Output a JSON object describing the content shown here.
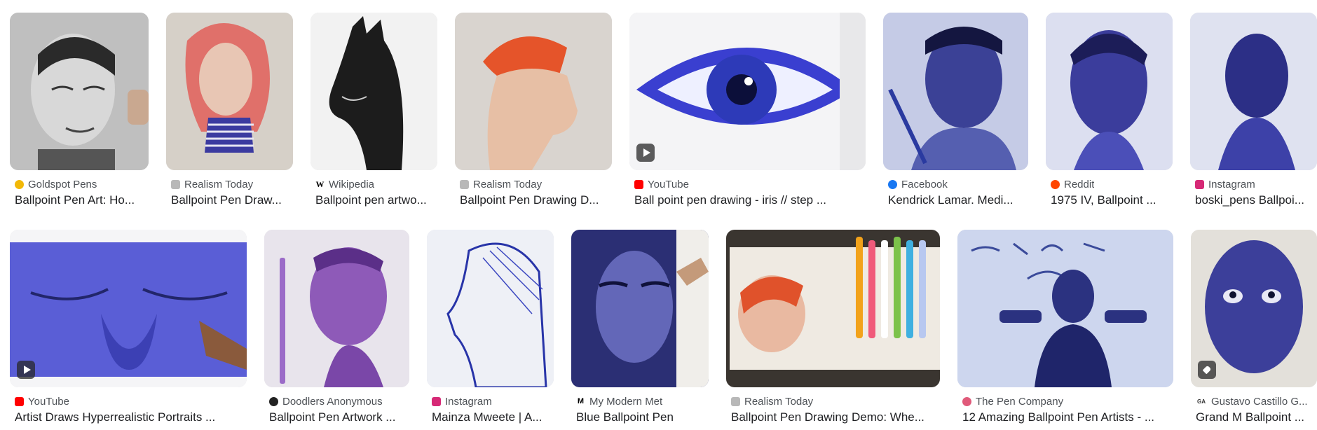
{
  "colors": {
    "text_primary": "#202124",
    "text_secondary": "#4d5156"
  },
  "row1": [
    {
      "source": "Goldspot Pens",
      "title": "Ballpoint Pen Art: Ho...",
      "icon": "goldspot-favicon-icon",
      "icon_color": "#f2b807"
    },
    {
      "source": "Realism Today",
      "title": "Ballpoint Pen Draw...",
      "icon": "realism-today-favicon-icon",
      "icon_color": "#b8b8b8"
    },
    {
      "source": "Wikipedia",
      "title": "Ballpoint pen artwo...",
      "icon": "wikipedia-favicon-icon",
      "icon_color": "#ffffff"
    },
    {
      "source": "Realism Today",
      "title": "Ballpoint Pen Drawing D...",
      "icon": "realism-today-favicon-icon",
      "icon_color": "#b8b8b8"
    },
    {
      "source": "YouTube",
      "title": "Ball point pen drawing - iris // step ...",
      "icon": "youtube-favicon-icon",
      "icon_color": "#ff0000",
      "video": true
    },
    {
      "source": "Facebook",
      "title": "Kendrick Lamar. Medi...",
      "icon": "facebook-favicon-icon",
      "icon_color": "#1877f2"
    },
    {
      "source": "Reddit",
      "title": "1975 IV, Ballpoint ...",
      "icon": "reddit-favicon-icon",
      "icon_color": "#ff4500"
    },
    {
      "source": "Instagram",
      "title": "boski_pens Ballpoi...",
      "icon": "instagram-favicon-icon",
      "icon_color": "#d62976"
    }
  ],
  "row2": [
    {
      "source": "YouTube",
      "title": "Artist Draws Hyperrealistic Portraits ...",
      "icon": "youtube-favicon-icon",
      "icon_color": "#ff0000",
      "video": true
    },
    {
      "source": "Doodlers Anonymous",
      "title": "Ballpoint Pen Artwork ...",
      "icon": "doodlers-anonymous-favicon-icon",
      "icon_color": "#222222"
    },
    {
      "source": "Instagram",
      "title": "Mainza Mweete | A...",
      "icon": "instagram-favicon-icon",
      "icon_color": "#d62976"
    },
    {
      "source": "My Modern Met",
      "title": "Blue Ballpoint Pen",
      "icon": "my-modern-met-favicon-icon",
      "icon_color": "#ffffff"
    },
    {
      "source": "Realism Today",
      "title": "Ballpoint Pen Drawing Demo: Whe...",
      "icon": "realism-today-favicon-icon",
      "icon_color": "#b8b8b8"
    },
    {
      "source": "The Pen Company",
      "title": "12 Amazing Ballpoint Pen Artists - ...",
      "icon": "pen-company-favicon-icon",
      "icon_color": "#e05a7a"
    },
    {
      "source": "Gustavo Castillo G...",
      "title": "Grand M Ballpoint ...",
      "icon": "gustavo-castillo-favicon-icon",
      "icon_color": "#ffffff",
      "tag": true
    }
  ],
  "favicon_glyphs": {
    "wikipedia": "W",
    "my_modern_met": "M",
    "gustavo": "GA"
  }
}
